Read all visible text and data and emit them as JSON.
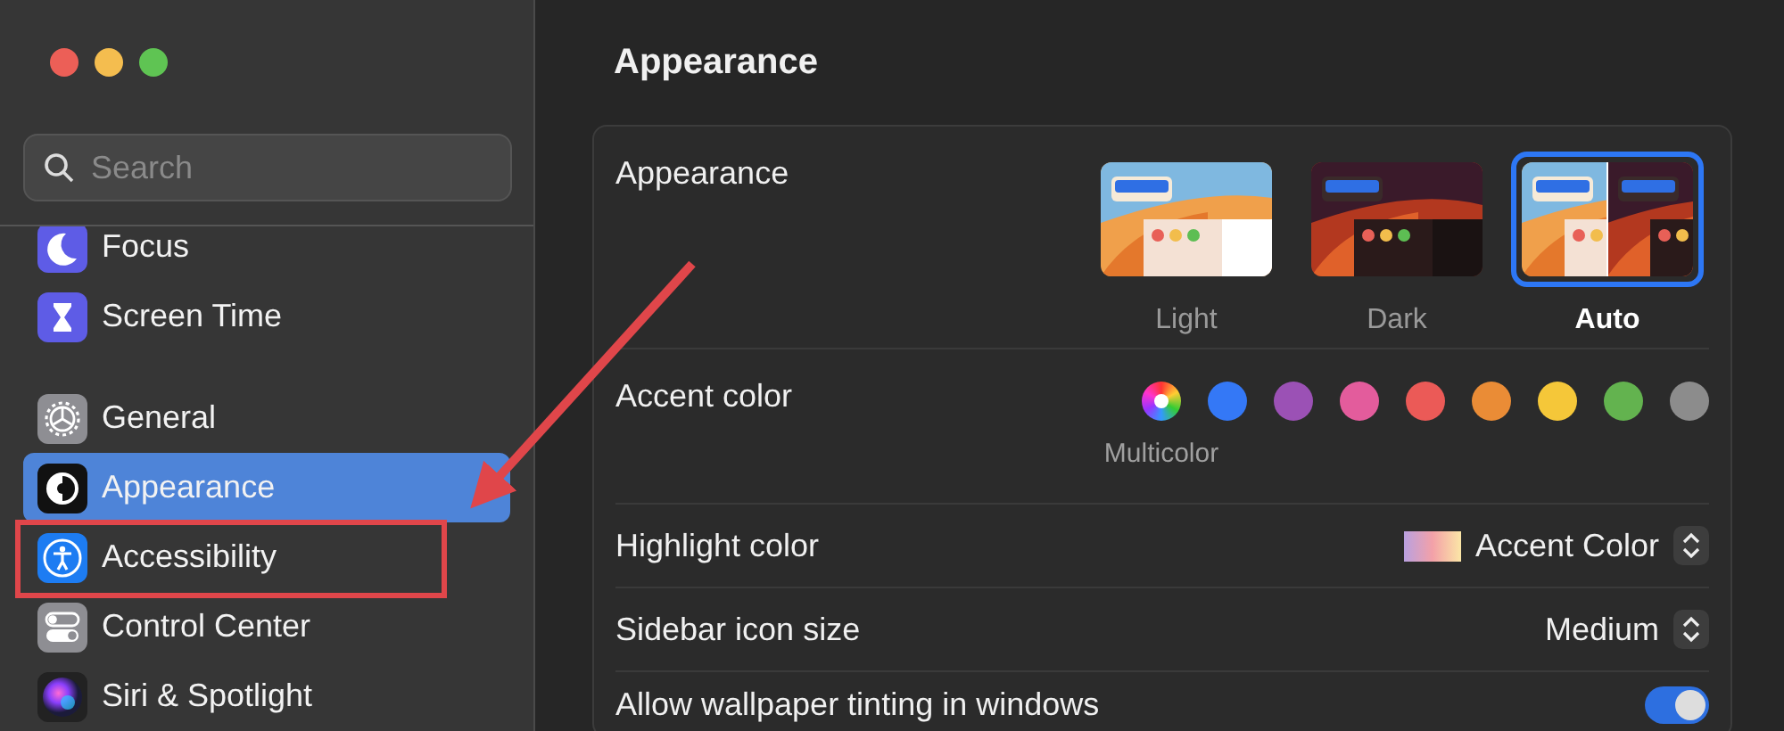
{
  "search": {
    "placeholder": "Search"
  },
  "sidebar": {
    "groups": [
      {
        "items": [
          {
            "label": "Focus",
            "selected": false
          },
          {
            "label": "Screen Time",
            "selected": false
          }
        ]
      },
      {
        "items": [
          {
            "label": "General",
            "selected": false
          },
          {
            "label": "Appearance",
            "selected": true
          },
          {
            "label": "Accessibility",
            "selected": false
          },
          {
            "label": "Control Center",
            "selected": false
          },
          {
            "label": "Siri & Spotlight",
            "selected": false
          }
        ]
      }
    ]
  },
  "page": {
    "title": "Appearance"
  },
  "settings": [
    {
      "kind": "appearance",
      "label": "Appearance",
      "options": [
        {
          "label": "Light",
          "selected": false
        },
        {
          "label": "Dark",
          "selected": false
        },
        {
          "label": "Auto",
          "selected": true
        }
      ]
    },
    {
      "kind": "accent",
      "label": "Accent color",
      "colors": [
        {
          "kind": "multicolor",
          "label": "Multicolor",
          "selected": true
        },
        {
          "kind": "solid",
          "color": "#3478f6",
          "selected": false
        },
        {
          "kind": "solid",
          "color": "#9b51b5",
          "selected": false
        },
        {
          "kind": "solid",
          "color": "#e35c9c",
          "selected": false
        },
        {
          "kind": "solid",
          "color": "#eb5a57",
          "selected": false
        },
        {
          "kind": "solid",
          "color": "#ea8c36",
          "selected": false
        },
        {
          "kind": "solid",
          "color": "#f5c739",
          "selected": false
        },
        {
          "kind": "solid",
          "color": "#63b34f",
          "selected": false
        },
        {
          "kind": "solid",
          "color": "#8c8c8c",
          "selected": false
        }
      ]
    },
    {
      "kind": "swatch-popup",
      "label": "Highlight color",
      "value": "Accent Color"
    },
    {
      "kind": "popup",
      "label": "Sidebar icon size",
      "value": "Medium"
    },
    {
      "kind": "toggle",
      "label": "Allow wallpaper tinting in windows",
      "on": true
    }
  ]
}
